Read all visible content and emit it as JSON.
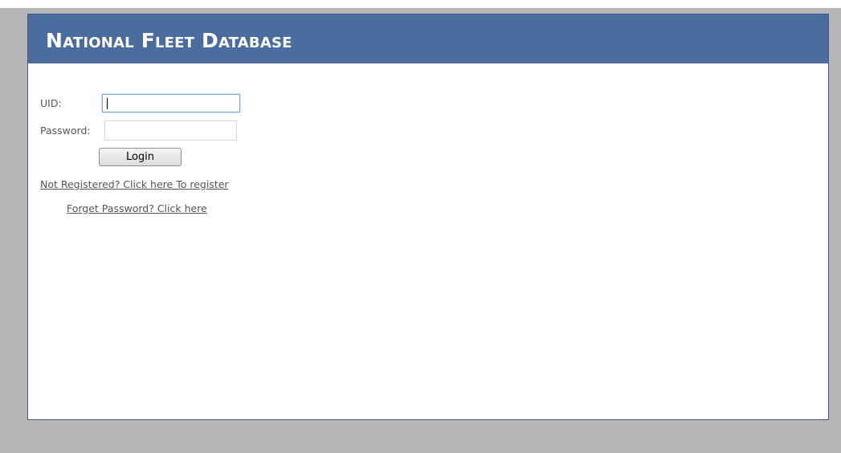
{
  "header": {
    "title": "National Fleet Database",
    "background_color": "#4a6c9f"
  },
  "login_form": {
    "uid_label": "UID:",
    "uid_value": "",
    "password_label": "Password:",
    "password_value": "",
    "login_button_label": "Login",
    "register_link": "Not Registered? Click here To register",
    "forgot_password_link": "Forget Password? Click here"
  },
  "colors": {
    "page_background": "#b6b6b9",
    "panel_border": "#3f5e8f",
    "text": "#555555"
  }
}
